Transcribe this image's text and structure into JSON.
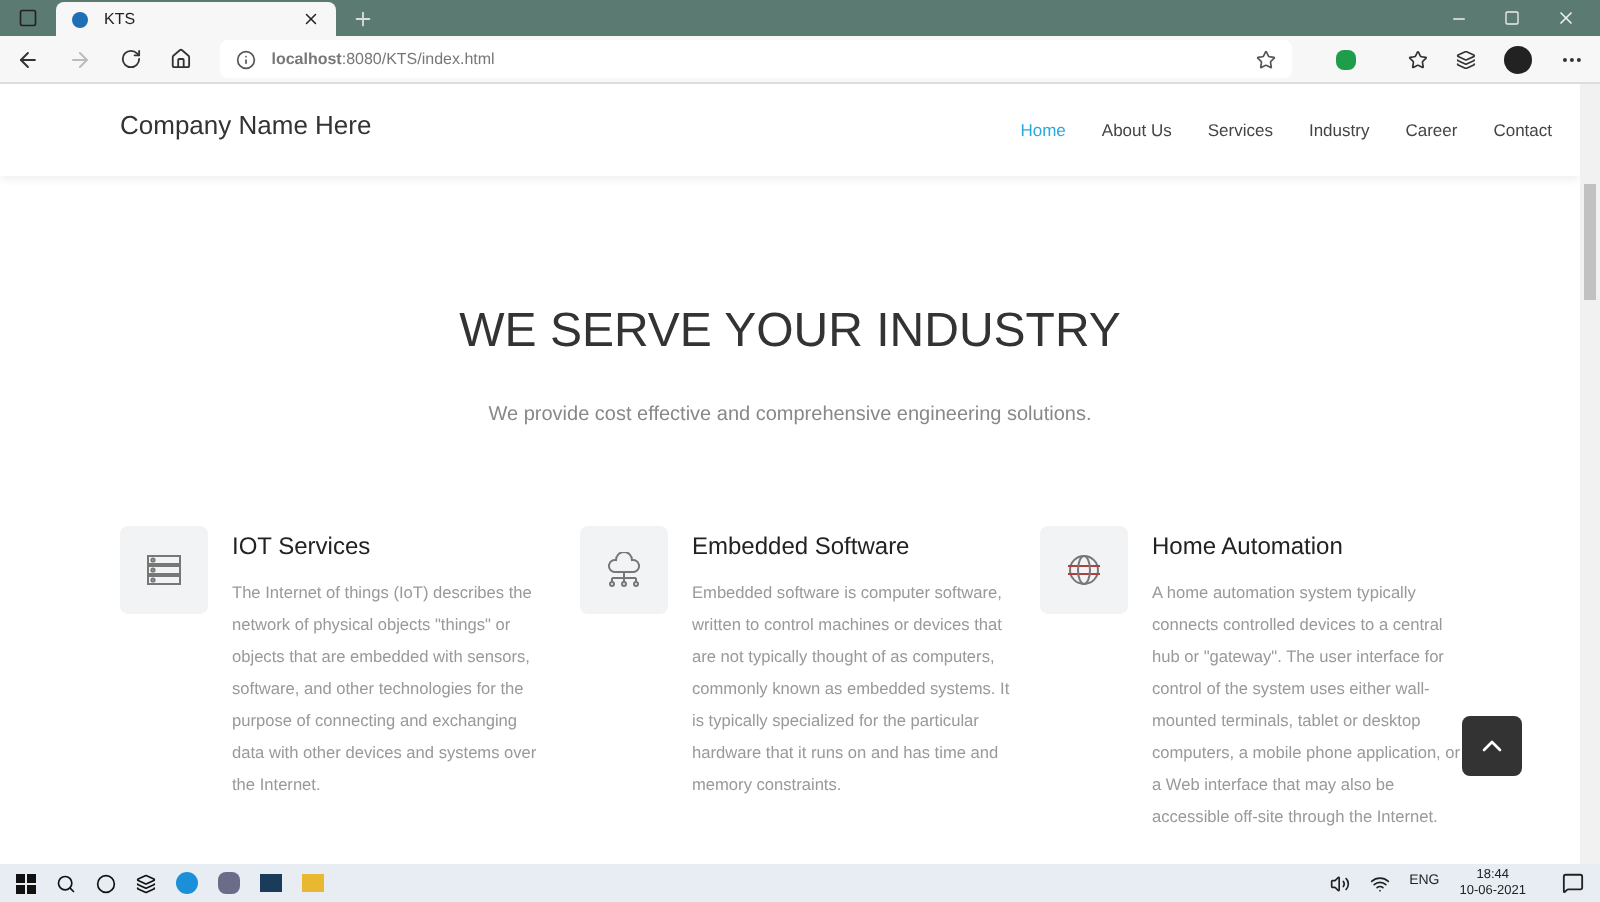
{
  "browser": {
    "tab_title": "KTS",
    "url": "**localhost**:8080/KTS/index.html"
  },
  "navbar": {
    "brand": "Company Name Here",
    "links": [
      {
        "label": "Home",
        "selected": true
      },
      {
        "label": "About Us",
        "selected": false
      },
      {
        "label": "Services",
        "selected": false
      },
      {
        "label": "Industry",
        "selected": false
      },
      {
        "label": "Career",
        "selected": false
      },
      {
        "label": "Contact",
        "selected": false
      }
    ]
  },
  "hero": {
    "title": "WE SERVE YOUR INDUSTRY",
    "subtitle": "We provide cost effective and comprehensive engineering solutions."
  },
  "services": [
    {
      "kind": "server",
      "title": "IOT Services",
      "text": "The Internet of things (IoT) describes the network of physical objects \"things\" or objects that are embedded with sensors, software, and other technologies for the purpose of connecting and exchanging data with other devices and systems over the Internet."
    },
    {
      "kind": "cloud",
      "title": "Embedded Software",
      "text": "Embedded software is computer software, written to control machines or devices that are not typically thought of as computers, commonly known as embedded systems. It is typically specialized for the particular hardware that it runs on and has time and memory constraints."
    },
    {
      "kind": "globe",
      "title": "Home Automation",
      "text": "A home automation system typically connects controlled devices to a central hub or \"gateway\". The user interface for control of the system uses either wall-mounted terminals, tablet or desktop computers, a mobile phone application, or a Web interface that may also be accessible off-site through the Internet."
    }
  ],
  "taskbar": {
    "language": "ENG",
    "time": "18:44",
    "date": "10-06-2021"
  }
}
